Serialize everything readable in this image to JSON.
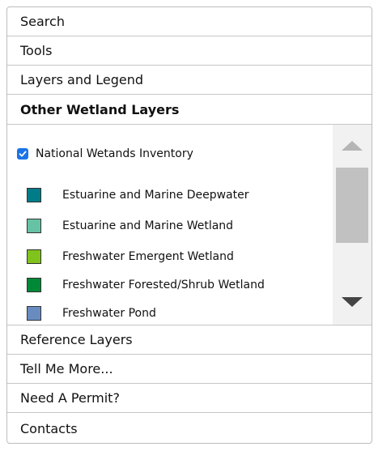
{
  "accordion": {
    "search": "Search",
    "tools": "Tools",
    "layers_legend": "Layers and Legend",
    "other_wetland": "Other Wetland Layers",
    "reference_layers": "Reference Layers",
    "tell_me_more": "Tell Me More...",
    "need_permit": "Need A Permit?",
    "contacts": "Contacts"
  },
  "nwi": {
    "label": "National Wetands Inventory",
    "checked": true
  },
  "legend": [
    {
      "label": "Estuarine and Marine Deepwater",
      "color": "#007c88"
    },
    {
      "label": "Estuarine and Marine Wetland",
      "color": "#66c2a5"
    },
    {
      "label": "Freshwater Emergent Wetland",
      "color": "#7fc31c"
    },
    {
      "label": "Freshwater Forested/Shrub Wetland",
      "color": "#008837"
    },
    {
      "label": "Freshwater Pond",
      "color": "#688cc0"
    }
  ],
  "colors": {
    "checkbox": "#1a73e8",
    "scrollbar_track": "#f1f1f1",
    "scrollbar_thumb": "#c1c1c1"
  }
}
